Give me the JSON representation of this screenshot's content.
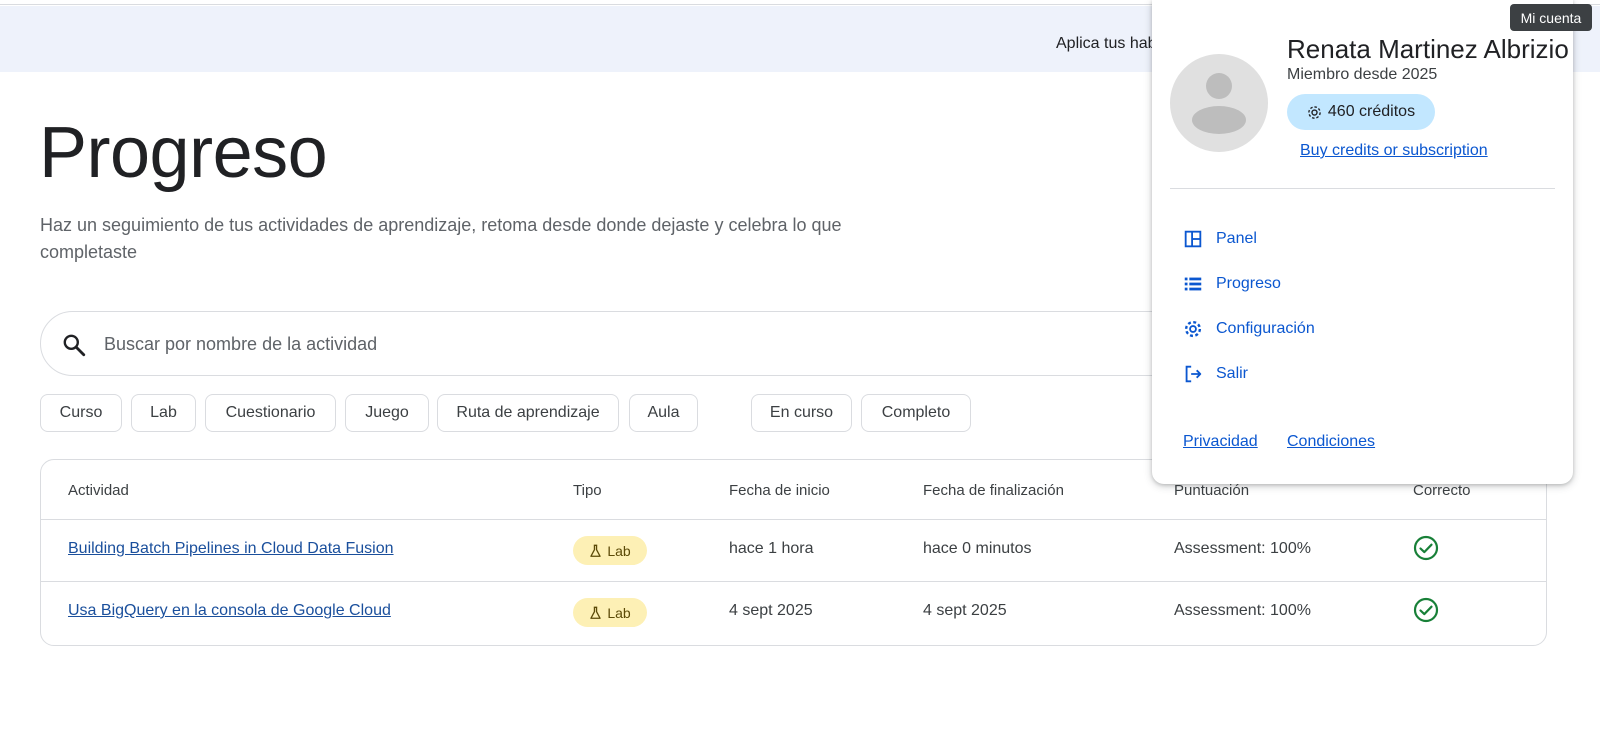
{
  "banner": {
    "text": "Aplica tus hab"
  },
  "page": {
    "title": "Progreso",
    "subtitle": "Haz un seguimiento de tus actividades de aprendizaje, retoma desde donde dejaste y celebra lo que completaste"
  },
  "search": {
    "placeholder": "Buscar por nombre de la actividad",
    "value": ""
  },
  "filters": {
    "type_chips": [
      "Curso",
      "Lab",
      "Cuestionario",
      "Juego",
      "Ruta de aprendizaje",
      "Aula"
    ],
    "status_chips": [
      "En curso",
      "Completo"
    ]
  },
  "table": {
    "headers": [
      "Actividad",
      "Tipo",
      "Fecha de inicio",
      "Fecha de finalización",
      "Puntuación",
      "Correcto"
    ],
    "rows": [
      {
        "activity": "Building Batch Pipelines in Cloud Data Fusion",
        "type": "Lab",
        "start": "hace 1 hora",
        "end": "hace 0 minutos",
        "score": "Assessment: 100%",
        "passed": true
      },
      {
        "activity": "Usa BigQuery en la consola de Google Cloud",
        "type": "Lab",
        "start": "4 sept 2025",
        "end": "4 sept 2025",
        "score": "Assessment: 100%",
        "passed": true
      }
    ]
  },
  "account_menu": {
    "tooltip": "Mi cuenta",
    "user_name": "Renata Martinez Albrizio",
    "member_since": "Miembro desde 2025",
    "credits": "460 créditos",
    "buy_link": "Buy credits or subscription",
    "items": [
      {
        "label": "Panel",
        "icon": "dashboard-icon"
      },
      {
        "label": "Progreso",
        "icon": "list-icon"
      },
      {
        "label": "Configuración",
        "icon": "gear-icon"
      },
      {
        "label": "Salir",
        "icon": "logout-icon"
      }
    ],
    "footer": {
      "privacy": "Privacidad",
      "terms": "Condiciones"
    }
  },
  "colors": {
    "banner_bg": "#eef2fb",
    "link_blue": "#0b57d0",
    "table_link": "#1a4f9c",
    "lab_badge_bg": "#fdf0b5",
    "credits_bg": "#c2e7ff",
    "check_green": "#188038"
  }
}
